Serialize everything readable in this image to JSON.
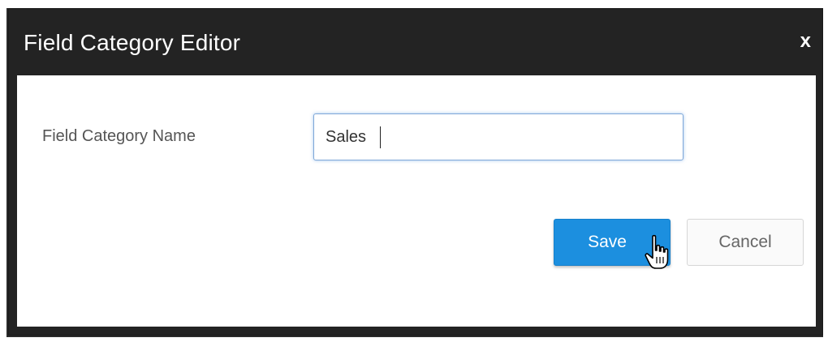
{
  "dialog": {
    "title": "Field Category Editor",
    "close_label": "x"
  },
  "form": {
    "field_label": "Field Category Name",
    "field_value": "Sales"
  },
  "actions": {
    "save_label": "Save",
    "cancel_label": "Cancel"
  },
  "colors": {
    "title_bar": "#232323",
    "save_button": "#1c8fdf",
    "input_focus_border": "#7ea7d8"
  },
  "icons": {
    "cursor": "hand-pointer-icon"
  }
}
